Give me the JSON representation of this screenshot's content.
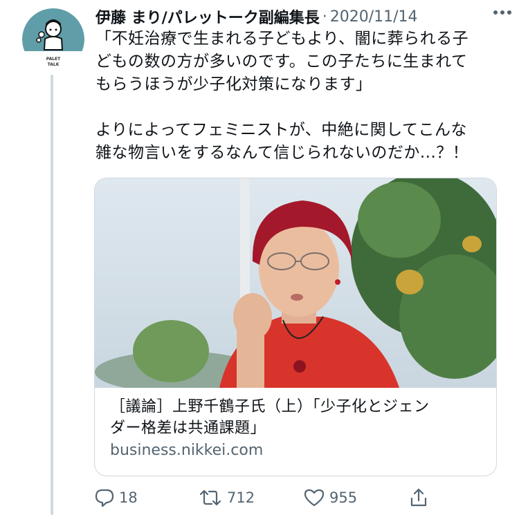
{
  "tweet": {
    "author_name": "伊藤 まり/パレットーク副編集長",
    "separator": "·",
    "date": "2020/11/14",
    "avatar_logo_text": "PALET TALK",
    "text_lines_1": [
      "「不妊治療で生まれる子どもより、闇に葬られる子",
      "どもの数の方が多いのです。この子たちに生まれて",
      "もらうほうが少子化対策になります」"
    ],
    "text_lines_2": [
      "よりによってフェミニストが、中絶に関してこんな",
      "雑な物言いをするなんて信じられないのだか...？！"
    ]
  },
  "card": {
    "title_line_1": "［議論］上野千鶴子氏（上）「少子化とジェン",
    "title_line_2": "ダー格差は共通課題」",
    "domain": "business.nikkei.com"
  },
  "actions": {
    "reply_count": "18",
    "retweet_count": "712",
    "like_count": "955"
  },
  "icons": {
    "more": "more-icon",
    "reply": "reply-icon",
    "retweet": "retweet-icon",
    "like": "like-icon",
    "share": "share-icon"
  },
  "colors": {
    "text": "#0f1419",
    "secondary": "#536471",
    "thread_line": "#cfd9de"
  }
}
